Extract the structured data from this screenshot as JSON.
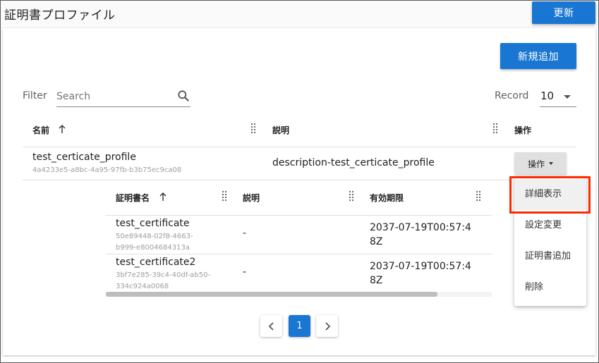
{
  "header": {
    "title": "証明書プロファイル",
    "refresh_label": "更新"
  },
  "toolbar": {
    "add_label": "新規追加",
    "filter_label": "Filter",
    "search_placeholder": "Search",
    "record_label": "Record",
    "record_value": "10"
  },
  "table": {
    "columns": [
      "名前",
      "説明",
      "操作"
    ],
    "rows": [
      {
        "name": "test_certicate_profile",
        "id": "4a4233e5-a8bc-4a95-97fb-b3b75ec9ca08",
        "description": "description-test_certicate_profile",
        "ops_label": "操作"
      }
    ]
  },
  "subtable": {
    "columns": [
      "証明書名",
      "説明",
      "有効期限"
    ],
    "rows": [
      {
        "name": "test_certificate",
        "id_line1": "50e89448-02f8-4663-",
        "id_line2": "b999-e8004684313a",
        "description": "-",
        "expiry_line1": "2037-07-19T00:57:4",
        "expiry_line2": "8Z"
      },
      {
        "name": "test_certificate2",
        "id_line1": "3bf7e285-39c4-40df-ab50-",
        "id_line2": "334c924a0068",
        "description": "-",
        "expiry_line1": "2037-07-19T00:57:4",
        "expiry_line2": "8Z"
      }
    ]
  },
  "menu": {
    "items": [
      "詳細表示",
      "設定変更",
      "証明書追加",
      "削除"
    ]
  },
  "pagination": {
    "current": "1"
  },
  "colors": {
    "primary": "#1976d2",
    "highlight": "#ff2a00"
  }
}
